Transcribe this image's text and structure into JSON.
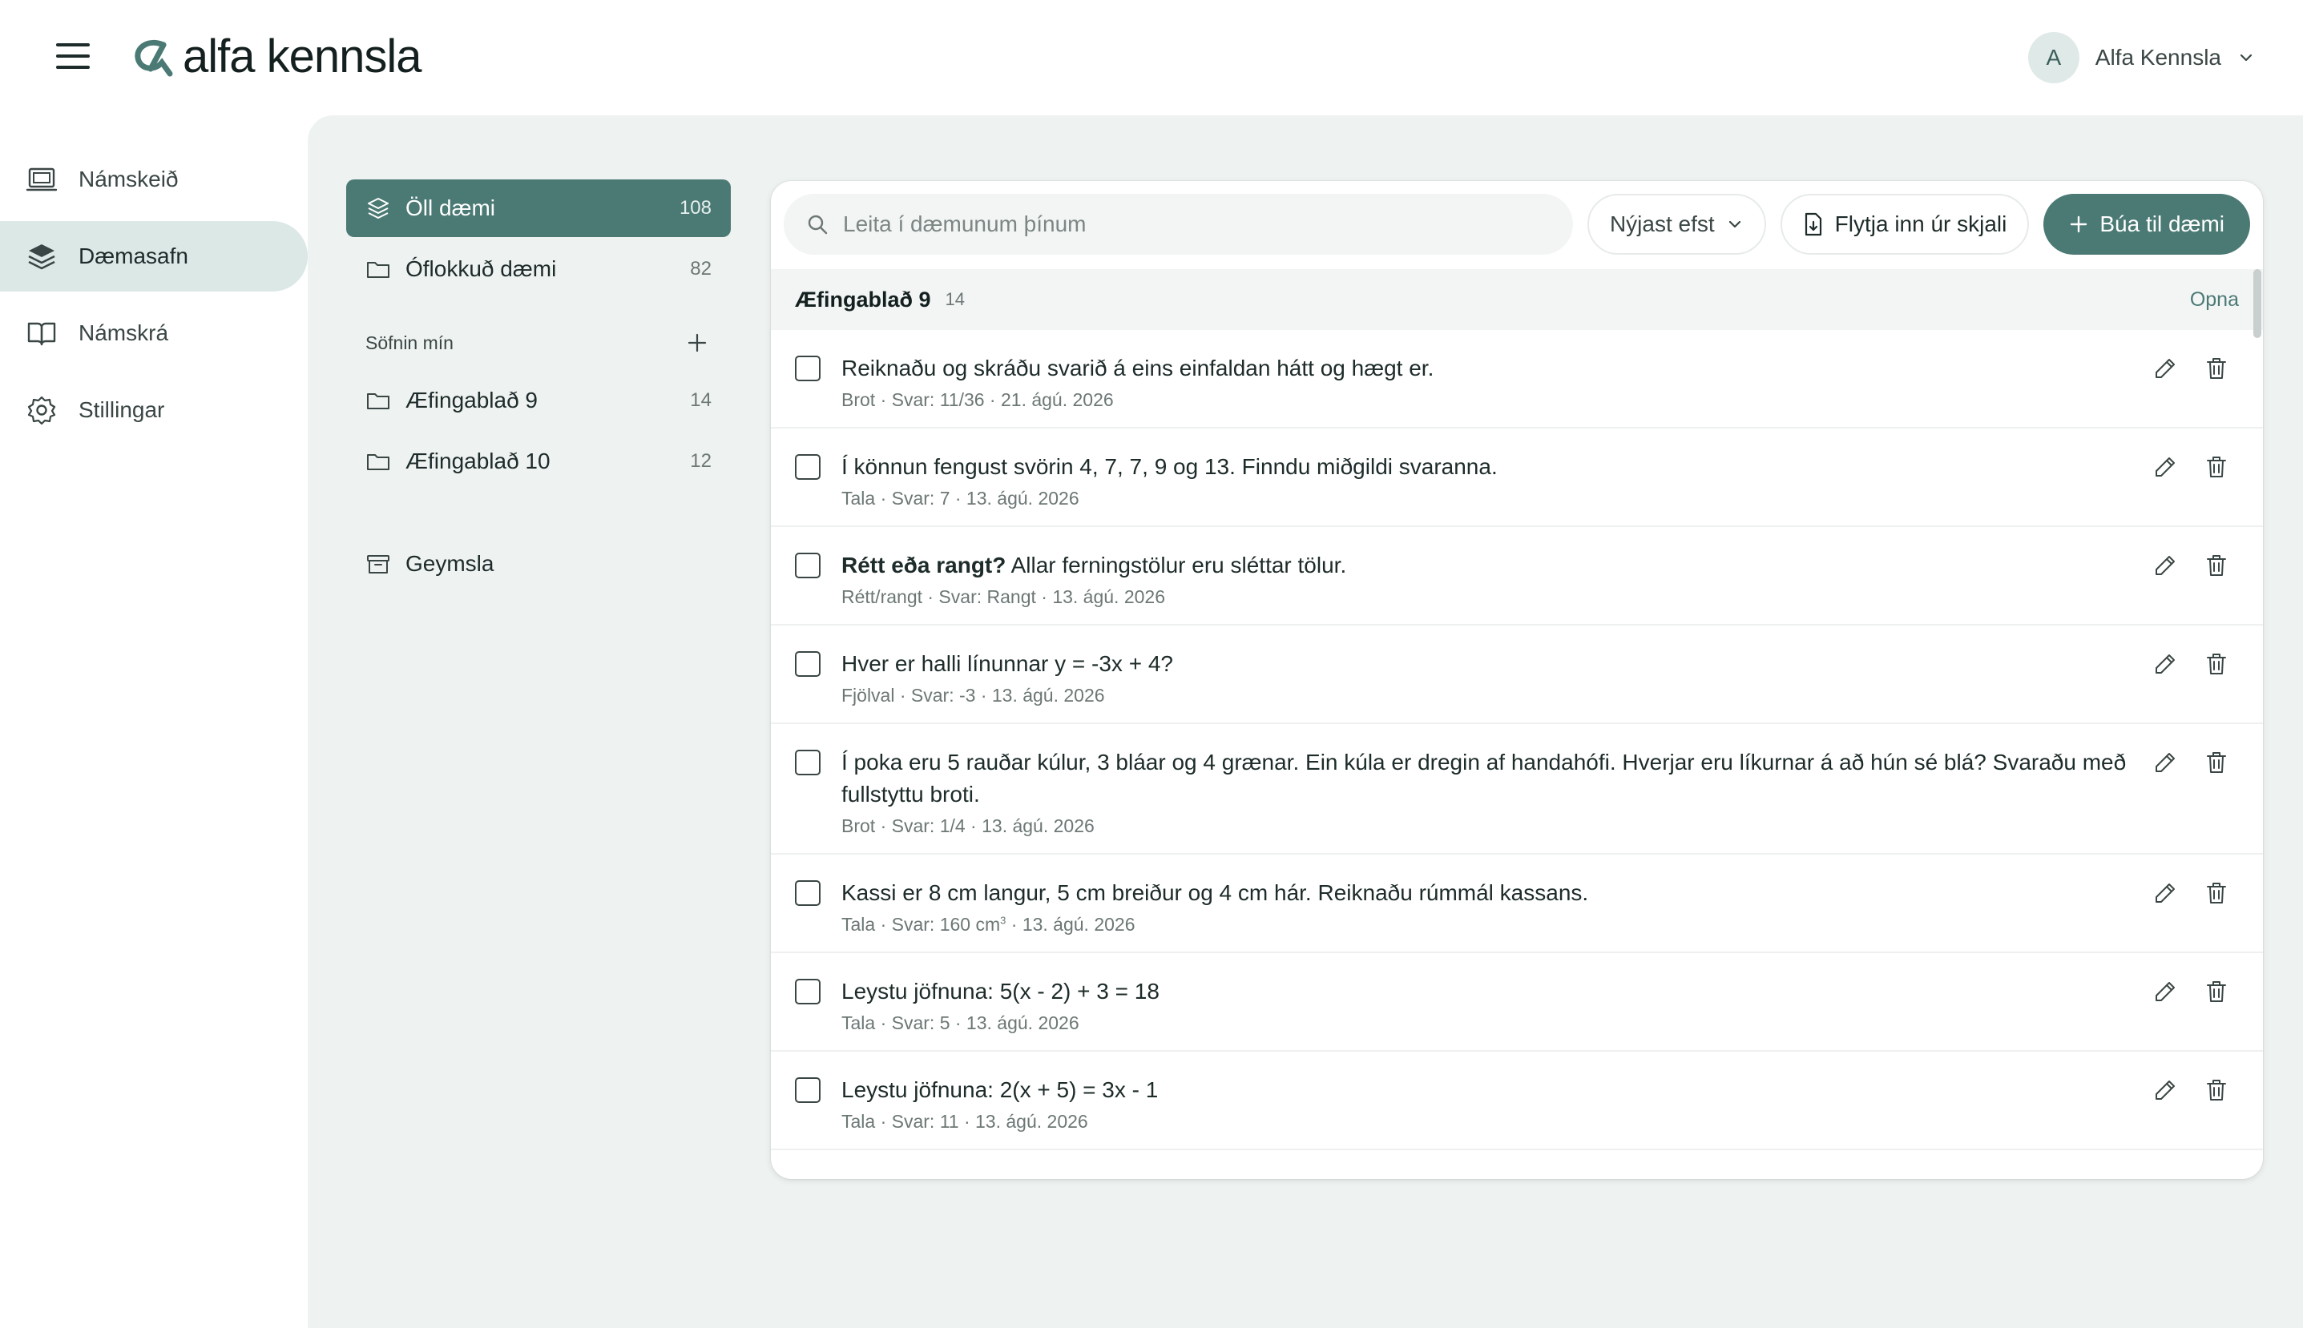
{
  "header": {
    "brand": "alfa kennsla",
    "user": {
      "initial": "A",
      "name": "Alfa Kennsla"
    }
  },
  "nav": [
    {
      "label": "Námskeið",
      "icon": "monitor-icon",
      "active": false
    },
    {
      "label": "Dæmasafn",
      "icon": "layers-icon",
      "active": true
    },
    {
      "label": "Námskrá",
      "icon": "book-icon",
      "active": false
    },
    {
      "label": "Stillingar",
      "icon": "gear-icon",
      "active": false
    }
  ],
  "collections": {
    "all": {
      "label": "Öll dæmi",
      "count": "108"
    },
    "unsorted": {
      "label": "Óflokkuð dæmi",
      "count": "82"
    },
    "section_title": "Söfnin mín",
    "mine": [
      {
        "label": "Æfingablað 9",
        "count": "14"
      },
      {
        "label": "Æfingablað 10",
        "count": "12"
      }
    ],
    "archive": {
      "label": "Geymsla"
    }
  },
  "toolbar": {
    "search_placeholder": "Leita í dæmunum þínum",
    "sort_label": "Nýjast efst",
    "import_label": "Flytja inn úr skjali",
    "create_label": "Búa til dæmi"
  },
  "group": {
    "title": "Æfingablað 9",
    "count": "14",
    "open_label": "Opna"
  },
  "questions": [
    {
      "prefix": "",
      "text": "Reiknaðu og skráðu svarið á eins einfaldan hátt og hægt er.",
      "meta": "Brot · Svar: 11/36 · 21. ágú. 2026"
    },
    {
      "prefix": "",
      "text": "Í könnun fengust svörin 4, 7, 7, 9 og 13. Finndu miðgildi svaranna.",
      "meta": "Tala · Svar: 7 · 13. ágú. 2026"
    },
    {
      "prefix": "Rétt eða rangt?",
      "text": " Allar ferningstölur eru sléttar tölur.",
      "meta": "Rétt/rangt · Svar: Rangt · 13. ágú. 2026"
    },
    {
      "prefix": "",
      "text": "Hver er halli línunnar y = -3x + 4?",
      "meta": "Fjölval · Svar: -3 · 13. ágú. 2026"
    },
    {
      "prefix": "",
      "text": "Í poka eru 5 rauðar kúlur, 3 bláar og 4 grænar. Ein kúla er dregin af handahófi. Hverjar eru líkurnar á að hún sé blá? Svaraðu með fullstyttu broti.",
      "meta": "Brot · Svar: 1/4 · 13. ágú. 2026"
    },
    {
      "prefix": "",
      "text": "Kassi er 8 cm langur, 5 cm breiður og 4 cm hár. Reiknaðu rúmmál kassans.",
      "meta_a": "Tala · Svar: 160 cm",
      "meta_sup": "3",
      "meta_b": " · 13. ágú. 2026"
    },
    {
      "prefix": "",
      "text": "Leystu jöfnuna: 5(x - 2) + 3 = 18",
      "meta": "Tala · Svar: 5 · 13. ágú. 2026"
    },
    {
      "prefix": "",
      "text": "Leystu jöfnuna: 2(x + 5) = 3x - 1",
      "meta": "Tala · Svar: 11 · 13. ágú. 2026"
    }
  ],
  "colors": {
    "accent": "#4b7a75",
    "nav_active_bg": "#dbe8e6",
    "main_bg": "#eef2f1"
  }
}
